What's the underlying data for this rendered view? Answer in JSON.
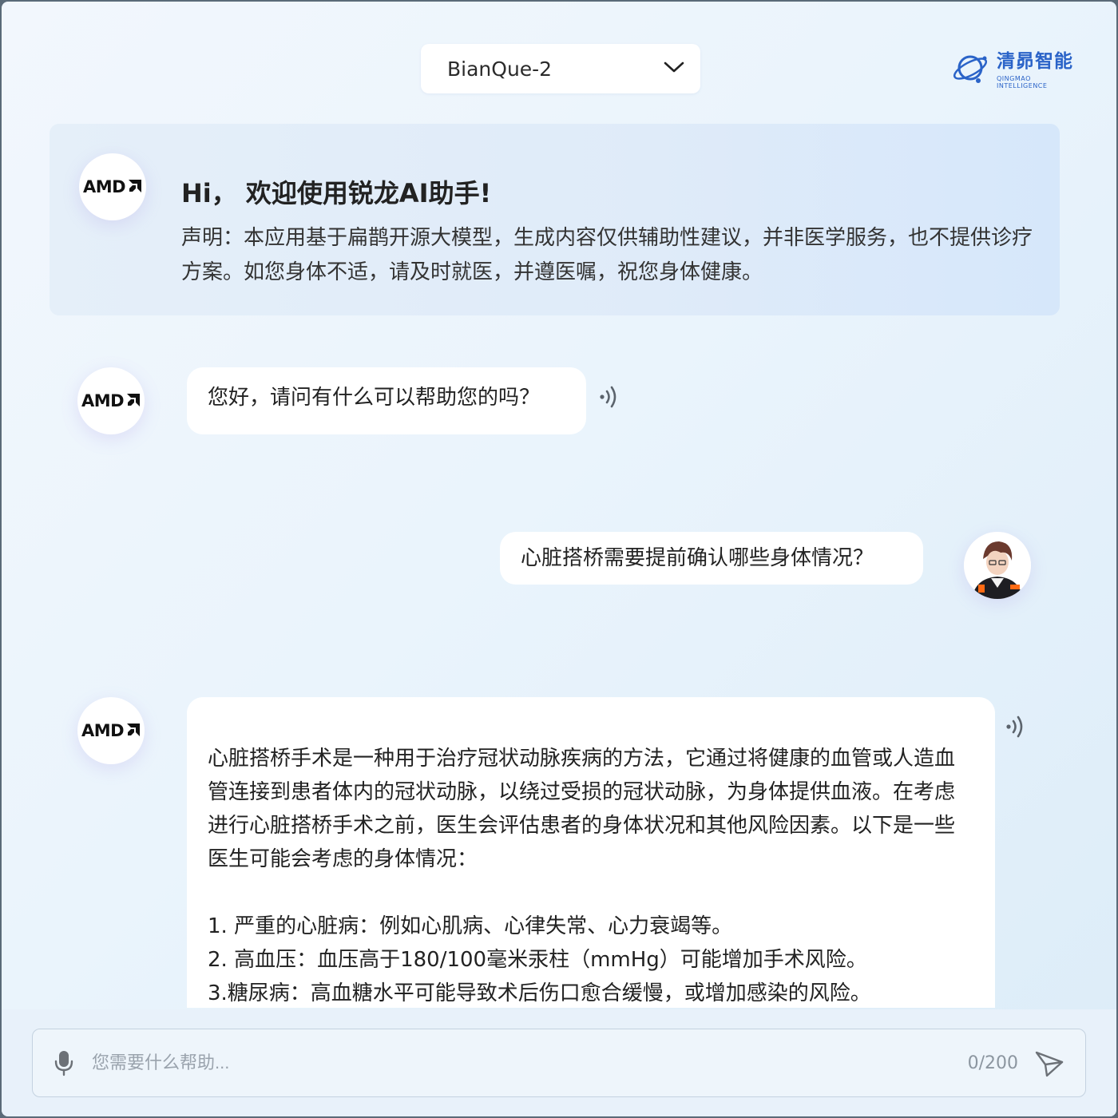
{
  "header": {
    "model_selector": {
      "value": "BianQue-2"
    },
    "logo": {
      "name_cn": "清昴智能",
      "name_en": "QINGMAO  INTELLIGENCE"
    }
  },
  "welcome": {
    "avatar_text": "AMD",
    "title": "Hi， 欢迎使用锐龙AI助手!",
    "disclaimer": "声明：本应用基于扁鹊开源大模型，生成内容仅供辅助性建议，并非医学服务，也不提供诊疗方案。如您身体不适，请及时就医，并遵医嘱，祝您身体健康。"
  },
  "messages": [
    {
      "role": "assistant",
      "avatar_text": "AMD",
      "text": "您好，请问有什么可以帮助您的吗？"
    },
    {
      "role": "user",
      "text": "心脏搭桥需要提前确认哪些身体情况？"
    },
    {
      "role": "assistant",
      "avatar_text": "AMD",
      "paragraph": " 心脏搭桥手术是一种用于治疗冠状动脉疾病的方法，它通过将健康的血管或人造血管连接到患者体内的冠状动脉，以绕过受损的冠状动脉，为身体提供血液。在考虑进行心脏搭桥手术之前，医生会评估患者的身体状况和其他风险因素。以下是一些医生可能会考虑的身体情况：",
      "items": [
        "1. 严重的心脏病：例如心肌病、心律失常、心力衰竭等。",
        "2. 高血压：血压高于180/100毫米汞柱（mmHg）可能增加手术风险。",
        "3.糖尿病：高血糖水平可能导致术后伤口愈合缓慢，或增加感染的风险。"
      ]
    }
  ],
  "composer": {
    "placeholder": "您需要什么帮助...",
    "counter": "0/200"
  },
  "icons": {
    "dropdown": "chevron-down-icon",
    "speaker": "speaker-icon",
    "mic": "microphone-icon",
    "send": "send-icon"
  },
  "colors": {
    "accent": "#2a63c8"
  }
}
